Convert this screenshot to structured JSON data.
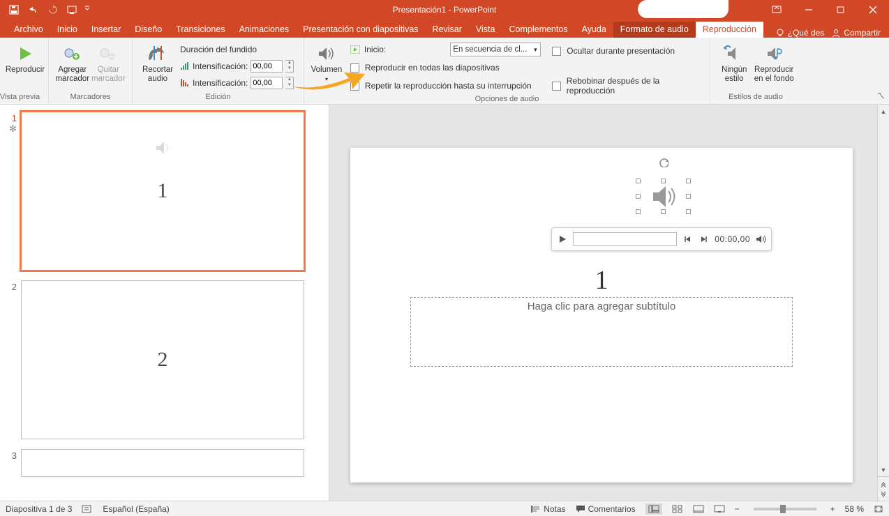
{
  "window": {
    "title": "Presentación1 - PowerPoint"
  },
  "qat": {
    "save": "save",
    "undo": "undo",
    "redo": "redo",
    "start": "start",
    "more": "more"
  },
  "tabs": {
    "archivo": "Archivo",
    "inicio": "Inicio",
    "insertar": "Insertar",
    "diseno": "Diseño",
    "transiciones": "Transiciones",
    "animaciones": "Animaciones",
    "presentacion": "Presentación con diapositivas",
    "revisar": "Revisar",
    "vista": "Vista",
    "complementos": "Complementos",
    "ayuda": "Ayuda",
    "formato_audio": "Formato de audio",
    "reproduccion": "Reproducción",
    "tell_me": "¿Qué des",
    "compartir": "Compartir"
  },
  "ribbon": {
    "vista_previa": {
      "label": "Vista previa",
      "reproducir": "Reproducir"
    },
    "marcadores": {
      "label": "Marcadores",
      "agregar": "Agregar\nmarcador",
      "quitar": "Quitar\nmarcador"
    },
    "edicion": {
      "label": "Edición",
      "recortar": "Recortar\naudio",
      "duracion": "Duración del fundido",
      "fade_in_label": "Intensificación:",
      "fade_in_value": "00,00",
      "fade_out_label": "Intensificación:",
      "fade_out_value": "00,00"
    },
    "opciones": {
      "label": "Opciones de audio",
      "volumen": "Volumen",
      "inicio_label": "Inicio:",
      "inicio_value": "En secuencia de cl...",
      "todas": "Reproducir en todas las diapositivas",
      "repetir": "Repetir la reproducción hasta su interrupción",
      "ocultar": "Ocultar durante presentación",
      "rebobinar": "Rebobinar después de la reproducción"
    },
    "estilos": {
      "label": "Estilos de audio",
      "ningun": "Ningún\nestilo",
      "fondo": "Reproducir\nen el fondo"
    }
  },
  "thumbs": {
    "slides": [
      {
        "num": "1",
        "title": "1"
      },
      {
        "num": "2",
        "title": "2"
      },
      {
        "num": "3",
        "title": ""
      }
    ]
  },
  "slide": {
    "title": "1",
    "subtitle_placeholder": "Haga clic para agregar subtítulo",
    "audio_time": "00:00,00"
  },
  "status": {
    "slide_count": "Diapositiva 1 de 3",
    "lang": "Español (España)",
    "notas": "Notas",
    "comentarios": "Comentarios",
    "zoom": "58 %"
  }
}
